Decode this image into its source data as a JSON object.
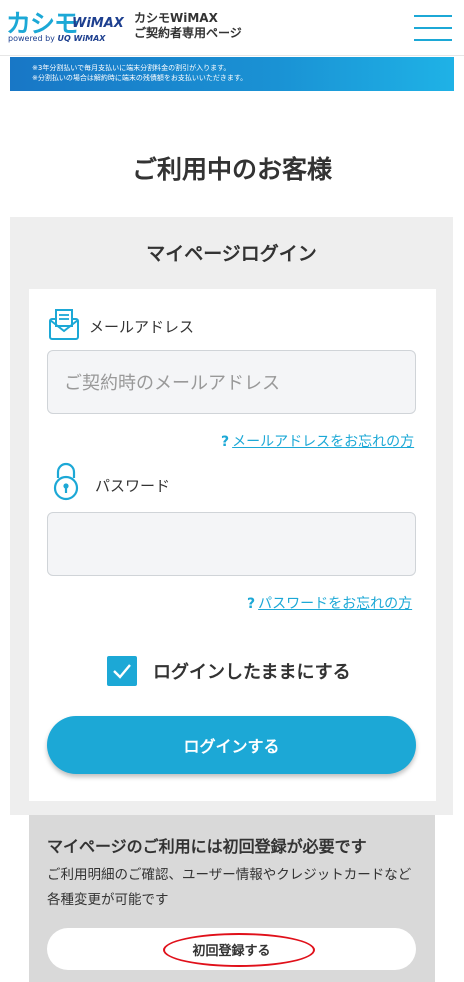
{
  "header": {
    "logo_main": "カシモ",
    "logo_wimax": "WiMAX",
    "logo_sub_prefix": "powered by",
    "logo_sub_brand": "UQ WiMAX",
    "title_line1": "カシモWiMAX",
    "title_line2": "ご契約者専用ページ"
  },
  "banner": {
    "line1": "※3年分割払いで毎月支払いに端末分割料金の割引が入ります。",
    "line2": "※分割払いの場合は解約時に端末の残債額をお支払いいただきます。"
  },
  "page_title": "ご利用中のお客様",
  "login": {
    "heading": "マイページログイン",
    "email_label": "メールアドレス",
    "email_placeholder": "ご契約時のメールアドレス",
    "email_forgot_mark": "?",
    "email_forgot": "メールアドレスをお忘れの方",
    "password_label": "パスワード",
    "password_value": "",
    "password_forgot_mark": "?",
    "password_forgot": "パスワードをお忘れの方",
    "remember_label": "ログインしたままにする",
    "remember_checked": true,
    "submit": "ログインする"
  },
  "registration": {
    "title": "マイページのご利用には初回登録が必要です",
    "description": "ご利用明細のご確認、ユーザー情報やクレジットカードなど各種変更が可能です",
    "button": "初回登録する"
  },
  "colors": {
    "accent": "#1ca8d6",
    "brand_dark": "#1d3f8f",
    "annotation_red": "#e0101a"
  },
  "icons": {
    "menu": "hamburger-menu-icon",
    "email": "envelope-icon",
    "password": "lock-icon",
    "check": "checkmark-icon"
  }
}
